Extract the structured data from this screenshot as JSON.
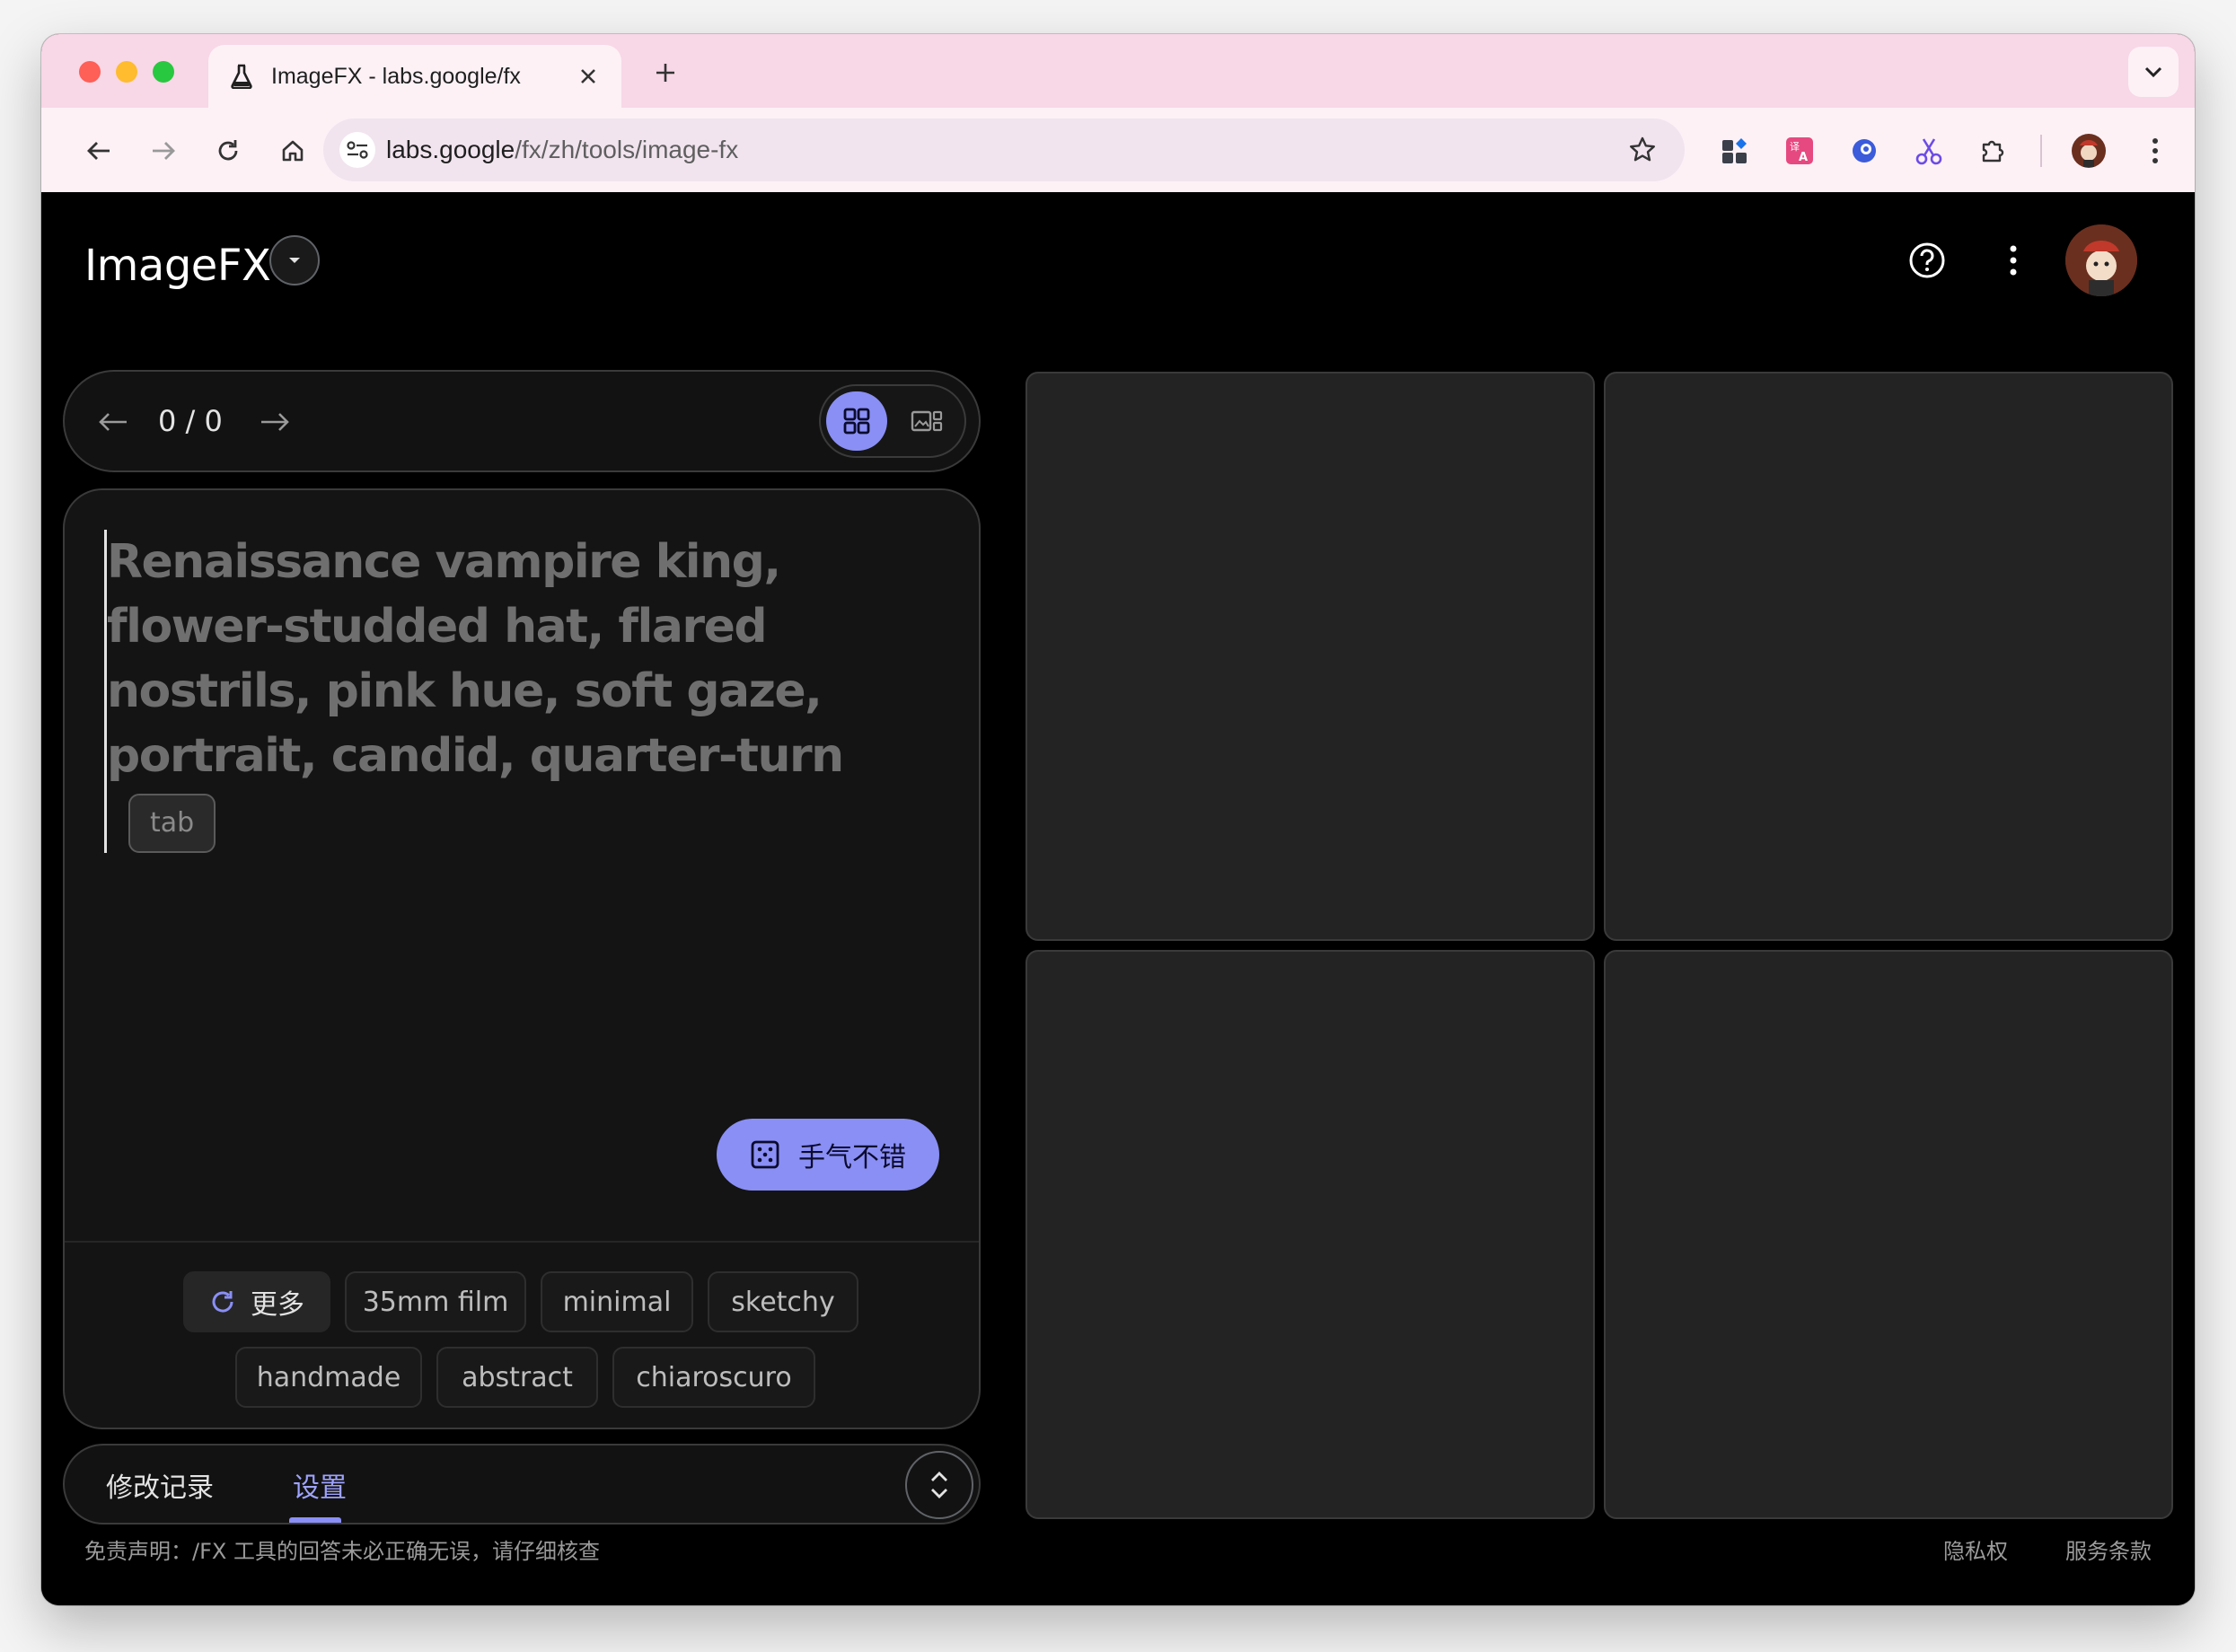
{
  "browser": {
    "tab_title": "ImageFX - labs.google/fx",
    "url_host": "labs.google",
    "url_path": "/fx/zh/tools/image-fx"
  },
  "app": {
    "name": "ImageFX",
    "pager_count": "0 / 0",
    "prompt_placeholder": "Renaissance vampire king, flower-studded hat, flared nostrils, pink hue, soft gaze, portrait, candid, quarter-turn",
    "tab_hint": "tab",
    "lucky_label": "手气不错",
    "chips": {
      "more": "更多",
      "c1": "35mm film",
      "c2": "minimal",
      "c3": "sketchy",
      "c4": "handmade",
      "c5": "abstract",
      "c6": "chiaroscuro"
    },
    "tabs": {
      "history": "修改记录",
      "settings": "设置"
    },
    "footer": {
      "disclaimer": "免责声明：/FX 工具的回答未必正确无误，请仔细核查",
      "privacy": "隐私权",
      "terms": "服务条款"
    }
  },
  "colors": {
    "accent": "#8a8ff5",
    "background": "#000000",
    "tabstrip": "#f8d7e6"
  },
  "icons": [
    "flask-icon",
    "close-icon",
    "plus-icon",
    "chevron-down-icon",
    "back-arrow-icon",
    "forward-arrow-icon",
    "reload-icon",
    "home-icon",
    "site-settings-icon",
    "star-icon",
    "puzzle-icon",
    "kebab-menu-icon",
    "help-icon",
    "grid-view-icon",
    "single-view-icon",
    "dice-icon",
    "refresh-icon",
    "expand-icon"
  ]
}
